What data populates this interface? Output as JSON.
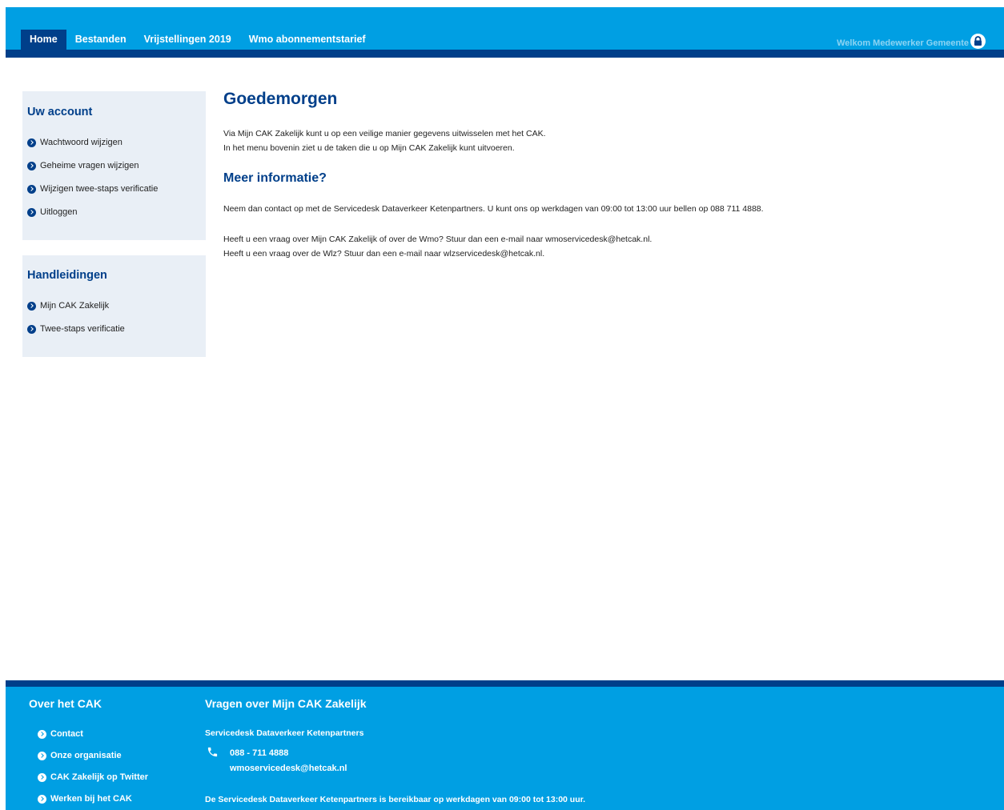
{
  "nav": {
    "items": [
      {
        "label": "Home",
        "active": true
      },
      {
        "label": "Bestanden",
        "active": false
      },
      {
        "label": "Vrijstellingen 2019",
        "active": false
      },
      {
        "label": "Wmo abonnementstarief",
        "active": false
      }
    ],
    "user_label": "Welkom Medewerker Gemeente",
    "lock_icon": "lock-icon"
  },
  "sidebar": {
    "account": {
      "title": "Uw account",
      "items": [
        {
          "label": "Wachtwoord wijzigen"
        },
        {
          "label": "Geheime vragen wijzigen"
        },
        {
          "label": "Wijzigen twee-staps verificatie"
        },
        {
          "label": "Uitloggen"
        }
      ]
    },
    "manuals": {
      "title": "Handleidingen",
      "items": [
        {
          "label": "Mijn CAK Zakelijk"
        },
        {
          "label": "Twee-staps verificatie"
        }
      ]
    }
  },
  "main": {
    "title": "Goedemorgen",
    "intro_1": "Via Mijn CAK Zakelijk kunt u op een veilige manier gegevens uitwisselen met het CAK.",
    "intro_2": "In het menu bovenin ziet u de taken die u op Mijn CAK Zakelijk kunt uitvoeren.",
    "subtitle": "Meer informatie?",
    "contact": "Neem dan contact op met de Servicedesk Dataverkeer Ketenpartners. U kunt ons op werkdagen van 09:00 tot 13:00 uur bellen op 088 711 4888.",
    "wmo_question": "Heeft u een vraag over Mijn CAK Zakelijk of over de Wmo? Stuur dan een e-mail naar wmoservicedesk@hetcak.nl.",
    "wlz_question": "Heeft u een vraag over de Wlz? Stuur dan een e-mail naar wlzservicedesk@hetcak.nl."
  },
  "footer": {
    "col1_title": "Over het CAK",
    "links": [
      {
        "label": "Contact"
      },
      {
        "label": "Onze organisatie"
      },
      {
        "label": "CAK Zakelijk op Twitter"
      },
      {
        "label": "Werken bij het CAK"
      }
    ],
    "col2_title": "Vragen over Mijn CAK Zakelijk",
    "servicedesk": "Servicedesk Dataverkeer Ketenpartners",
    "phone": "088 - 711 4888",
    "email": "wmoservicedesk@hetcak.nl",
    "availability": "De Servicedesk Dataverkeer Ketenpartners is bereikbaar op werkdagen van 09:00 tot 13:00 uur."
  },
  "colors": {
    "brand_blue": "#009fe3",
    "dark_blue": "#003f8a",
    "panel_bg": "#e9eff6"
  }
}
